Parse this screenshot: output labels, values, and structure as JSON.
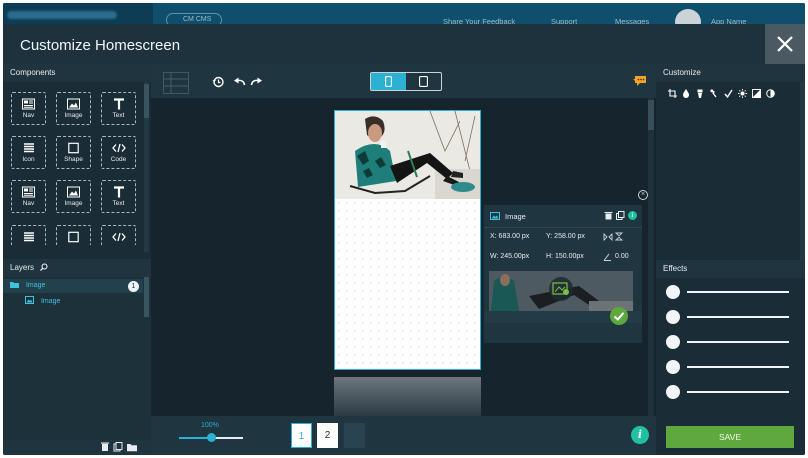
{
  "background": {
    "cms_label": "CM CMS",
    "links": [
      "Share Your Feedback",
      "Support",
      "Messages",
      "App Name"
    ]
  },
  "modal": {
    "title": "Customize Homescreen"
  },
  "components": {
    "heading": "Components",
    "tiles": [
      {
        "label": "Nav",
        "icon": "nav-icon"
      },
      {
        "label": "Image",
        "icon": "image-icon"
      },
      {
        "label": "Text",
        "icon": "text-icon"
      },
      {
        "label": "Icon",
        "icon": "list-icon"
      },
      {
        "label": "Shape",
        "icon": "square-icon"
      },
      {
        "label": "Code",
        "icon": "code-icon"
      },
      {
        "label": "Nav",
        "icon": "nav-icon"
      },
      {
        "label": "Image",
        "icon": "image-icon"
      },
      {
        "label": "Text",
        "icon": "text-icon"
      },
      {
        "label": "",
        "icon": "list-icon"
      },
      {
        "label": "",
        "icon": "square-icon"
      },
      {
        "label": "",
        "icon": "code-icon"
      }
    ]
  },
  "layers": {
    "heading": "Layers",
    "items": [
      {
        "label": "Image",
        "badge": "1"
      },
      {
        "label": "Image"
      }
    ]
  },
  "toolbar": {
    "device_modes": [
      "phone",
      "tablet"
    ],
    "active_device": "phone"
  },
  "properties": {
    "title": "Image",
    "x": "X: 683.00 px",
    "y": "Y: 258.00 px",
    "w": "W: 245.00px",
    "h": "H: 150.00px",
    "angle": "0.00"
  },
  "bottom": {
    "zoom": "100%",
    "zoom_fraction": 0.5,
    "pages": [
      "1",
      "2"
    ],
    "active_page": "1"
  },
  "customize": {
    "heading": "Customize",
    "icons": [
      "crop-icon",
      "drop-icon",
      "paint-icon",
      "eyedropper-icon",
      "check-icon",
      "brightness-icon",
      "image-adjust-icon",
      "contrast-icon"
    ]
  },
  "effects": {
    "heading": "Effects",
    "count": 5
  },
  "save_label": "SAVE",
  "colors": {
    "accent": "#2cb1d3",
    "save": "#5ea83d",
    "info": "#20c0a2",
    "panel": "#1a2c36"
  }
}
